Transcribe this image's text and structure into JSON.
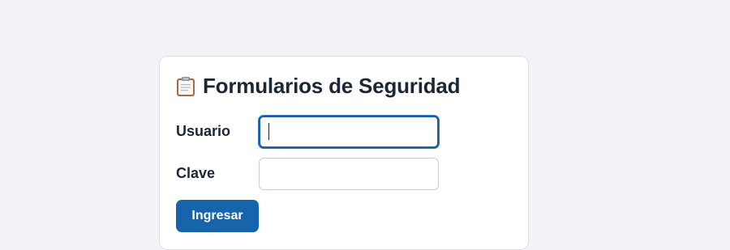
{
  "page": {
    "background": "#f2f3f6"
  },
  "form": {
    "icon": "clipboard-icon",
    "title": "Formularios de Seguridad",
    "fields": [
      {
        "label": "Usuario",
        "value": "",
        "focused": true
      },
      {
        "label": "Clave",
        "value": "",
        "focused": false
      }
    ],
    "submit_label": "Ingresar",
    "colors": {
      "accent": "#1664ab",
      "focus_border": "#1a5fa8",
      "text": "#1d2733"
    }
  }
}
